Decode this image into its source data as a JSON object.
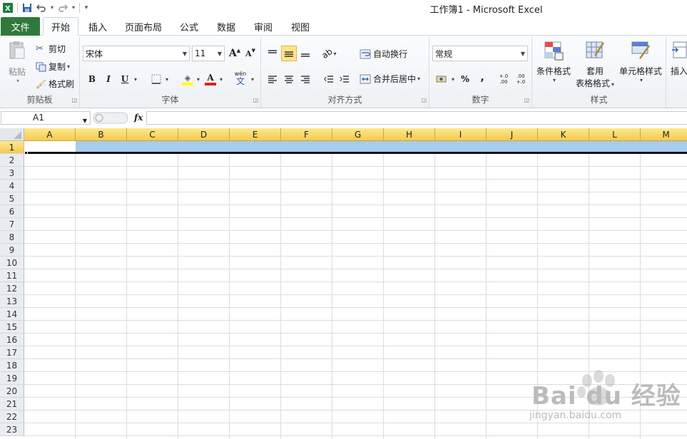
{
  "window": {
    "title": "工作簿1  -  Microsoft Excel"
  },
  "qat": {
    "icons": [
      "excel-logo-icon",
      "save-icon",
      "undo-icon",
      "redo-icon",
      "customize-qat-icon"
    ]
  },
  "tabs": {
    "file": "文件",
    "home": "开始",
    "insert": "插入",
    "page_layout": "页面布局",
    "formulas": "公式",
    "data": "数据",
    "review": "审阅",
    "view": "视图"
  },
  "clipboard": {
    "label": "剪贴板",
    "paste": "粘贴",
    "cut": "剪切",
    "copy": "复制",
    "format_painter": "格式刷"
  },
  "font": {
    "label": "字体",
    "family": "宋体",
    "size": "11",
    "bold": "B",
    "italic": "I",
    "underline": "U",
    "font_color_letter": "A",
    "phonetic": "wén",
    "phonetic_char": "文",
    "grow": "A",
    "shrink": "A"
  },
  "alignment": {
    "label": "对齐方式",
    "wrap_text": "自动换行",
    "merge_center": "合并后居中"
  },
  "number": {
    "label": "数字",
    "format": "常规",
    "percent": "%",
    "comma": ",",
    "inc_decimal": "+.0 .00",
    "dec_decimal": ".00 +.0"
  },
  "styles": {
    "label": "样式",
    "conditional": "条件格式",
    "table_line1": "套用",
    "table_line2": "表格格式",
    "cell_styles": "单元格样式"
  },
  "cells_group": {
    "insert": "插入"
  },
  "formula_bar": {
    "name_box": "A1",
    "fx": "fx",
    "content": ""
  },
  "grid": {
    "columns": [
      "A",
      "B",
      "C",
      "D",
      "E",
      "F",
      "G",
      "H",
      "I",
      "J",
      "K",
      "L",
      "M"
    ],
    "rows": [
      "1",
      "2",
      "3",
      "4",
      "5",
      "6",
      "7",
      "8",
      "9",
      "10",
      "11",
      "12",
      "13",
      "14",
      "15",
      "16",
      "17",
      "18",
      "19",
      "20",
      "21",
      "22",
      "23"
    ],
    "selected_row": "1",
    "active_cell": "A1"
  },
  "colors": {
    "file_tab": "#2f7a3b",
    "header_highlight": "#f7c84f",
    "selection": "#a8cbee"
  },
  "watermark": {
    "brand": "Bai du 经验",
    "url": "jingyan.baidu.com"
  }
}
